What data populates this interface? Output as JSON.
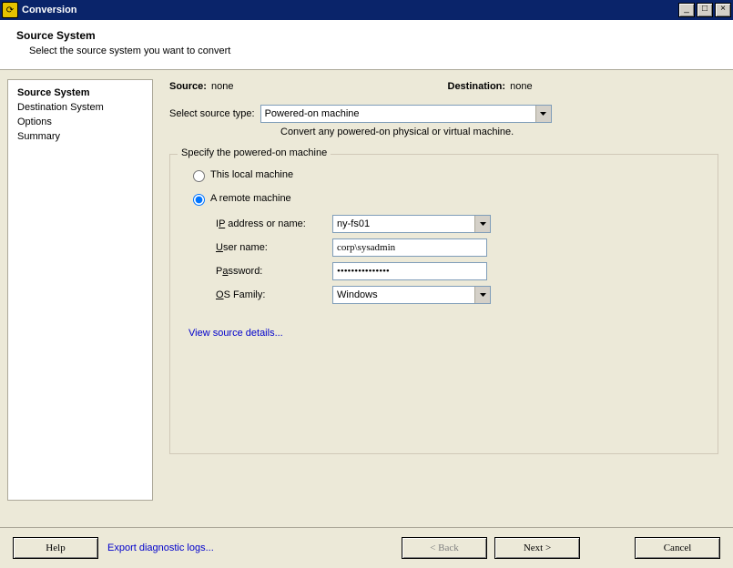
{
  "window": {
    "title": "Conversion"
  },
  "header": {
    "heading": "Source System",
    "subheading": "Select the source system you want to convert"
  },
  "sidebar": {
    "items": [
      {
        "label": "Source System",
        "current": true
      },
      {
        "label": "Destination System",
        "current": false
      },
      {
        "label": "Options",
        "current": false
      },
      {
        "label": "Summary",
        "current": false
      }
    ]
  },
  "main": {
    "source_label": "Source:",
    "source_value": "none",
    "destination_label": "Destination:",
    "destination_value": "none",
    "select_source_type_label": "Select source type:",
    "source_type_selected": "Powered-on machine",
    "source_type_hint": "Convert any powered-on physical or virtual machine.",
    "groupbox_title": "Specify the powered-on machine",
    "radio_local_label": "This local machine",
    "radio_remote_label": "A remote machine",
    "radio_selected": "remote",
    "fields": {
      "ip_label_pre": "I",
      "ip_label_u": "P",
      "ip_label_post": " address or name:",
      "ip_value": "ny-fs01",
      "user_label_pre": "",
      "user_label_u": "U",
      "user_label_post": "ser name:",
      "user_value": "corp\\sysadmin",
      "pass_label_pre": "P",
      "pass_label_u": "a",
      "pass_label_post": "ssword:",
      "pass_value": "•••••••••••••••",
      "os_label_pre": "",
      "os_label_u": "O",
      "os_label_post": "S Family:",
      "os_selected": "Windows"
    },
    "view_details_link": "View source details..."
  },
  "footer": {
    "help_label_u": "H",
    "help_label_post": "elp",
    "export_link": "Export diagnostic logs...",
    "back_label": "< Back",
    "next_label": "Next >",
    "cancel_label": "Cancel",
    "back_enabled": false
  }
}
